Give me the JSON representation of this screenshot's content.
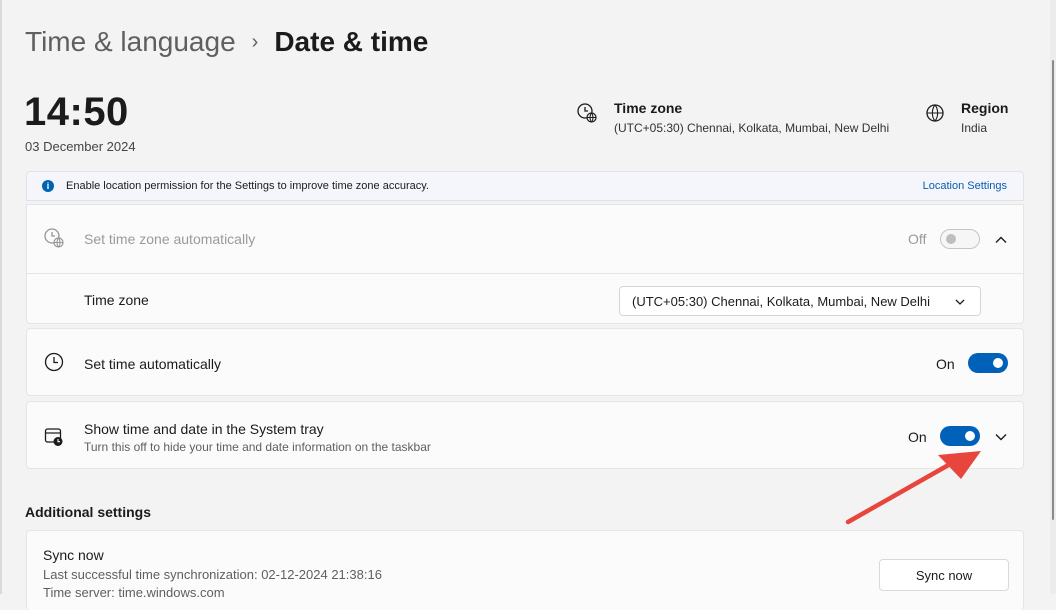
{
  "breadcrumb": {
    "parent": "Time & language",
    "separator": "›",
    "current": "Date & time"
  },
  "clock": {
    "time": "14:50",
    "date": "03 December 2024"
  },
  "time_zone_info": {
    "icon": "clock-globe-icon",
    "title": "Time zone",
    "value": "(UTC+05:30) Chennai, Kolkata, Mumbai, New Delhi"
  },
  "region_info": {
    "icon": "globe-icon",
    "title": "Region",
    "value": "India"
  },
  "banner": {
    "icon": "info-icon",
    "text": "Enable location permission for the Settings to improve time zone accuracy.",
    "link": "Location Settings"
  },
  "settings": {
    "set_tz_auto": {
      "icon": "clock-globe-icon",
      "label": "Set time zone automatically",
      "state": "Off",
      "enabled": false
    },
    "time_zone_row": {
      "label": "Time zone",
      "selected": "(UTC+05:30) Chennai, Kolkata, Mumbai, New Delhi"
    },
    "set_time_auto": {
      "icon": "clock-icon",
      "label": "Set time automatically",
      "state": "On"
    },
    "show_in_tray": {
      "icon": "calendar-clock-icon",
      "label": "Show time and date in the System tray",
      "description": "Turn this off to hide your time and date information on the taskbar",
      "state": "On"
    }
  },
  "additional": {
    "title": "Additional settings",
    "sync": {
      "title": "Sync now",
      "last_sync": "Last successful time synchronization: 02-12-2024 21:38:16",
      "server": "Time server: time.windows.com",
      "button": "Sync now"
    }
  },
  "colors": {
    "accent": "#0061b8",
    "annotation_arrow": "#e8453c",
    "link": "#0a5cad"
  }
}
